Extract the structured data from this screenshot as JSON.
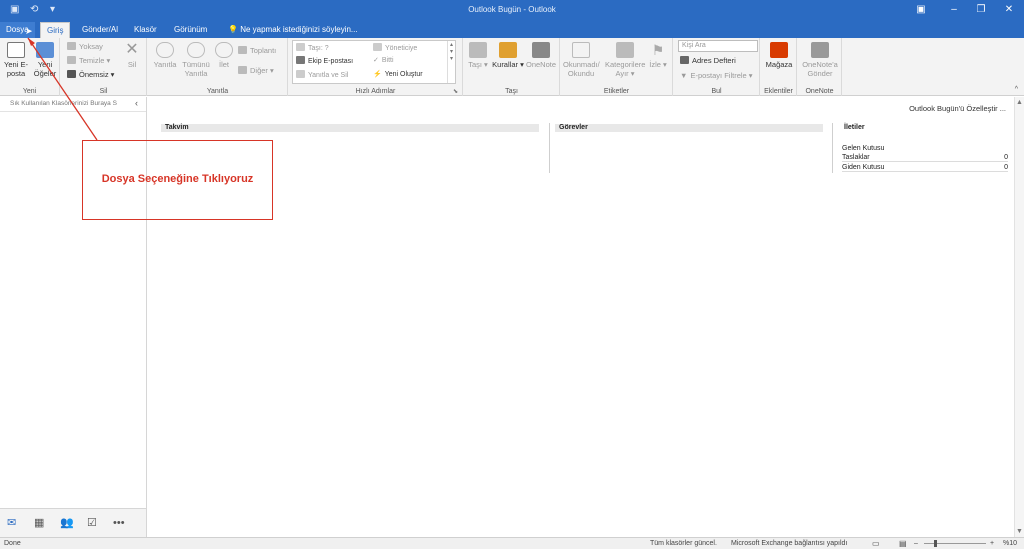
{
  "window": {
    "title": "Outlook Bugün - Outlook"
  },
  "tabs": [
    {
      "label": "Dosya"
    },
    {
      "label": "Giriş"
    },
    {
      "label": "Gönder/Al"
    },
    {
      "label": "Klasör"
    },
    {
      "label": "Görünüm"
    }
  ],
  "tell_me": "Ne yapmak istediğinizi söyleyin...",
  "ribbon": {
    "yeni": {
      "label": "Yeni",
      "new_email": "Yeni E-posta",
      "new_items": "Yeni Öğeler"
    },
    "sil": {
      "label": "Sil",
      "ignore": "Yoksay",
      "clean": "Temizle",
      "junk": "Önemsiz",
      "delete": "Sil"
    },
    "yanitla": {
      "label": "Yanıtla",
      "reply": "Yanıtla",
      "reply_all": "Tümünü Yanıtla",
      "forward": "İlet",
      "meeting": "Toplantı",
      "more": "Diğer"
    },
    "hizli": {
      "label": "Hızlı Adımlar",
      "move_to": "Taşı: ?",
      "team_email": "Ekip E-postası",
      "reply_delete": "Yanıtla ve Sil",
      "manager": "Yöneticiye",
      "done": "Bitti",
      "create_new": "Yeni Oluştur"
    },
    "tasi": {
      "label": "Taşı",
      "move": "Taşı",
      "rules": "Kurallar",
      "onenote": "OneNote"
    },
    "etiketler": {
      "label": "Etiketler",
      "unread_read": "Okunmadı/ Okundu",
      "categorize": "Kategorilere Ayır",
      "follow_up": "İzle"
    },
    "bul": {
      "label": "Bul",
      "search_placeholder": "Kişi Ara",
      "address_book": "Adres Defteri",
      "filter_email": "E-postayı Filtrele"
    },
    "eklentiler": {
      "label": "Eklentiler",
      "store": "Mağaza"
    },
    "onenote": {
      "label": "OneNote",
      "send": "OneNote'a Gönder"
    }
  },
  "nav": {
    "favorites_hint": "Sık Kullanılan Klasörlerinizi Buraya S"
  },
  "main": {
    "customize": "Outlook Bugün'ü Özelleştir ...",
    "calendar": "Takvim",
    "tasks": "Görevler",
    "messages": {
      "title": "İletiler",
      "rows": [
        {
          "name": "Gelen Kutusu",
          "count": ""
        },
        {
          "name": "Taslaklar",
          "count": "0"
        },
        {
          "name": "Giden Kutusu",
          "count": "0"
        }
      ]
    }
  },
  "annotation": {
    "text": "Dosya Seçeneğine Tıklıyoruz",
    "color": "#d73527"
  },
  "status": {
    "left": "Done",
    "folders": "Tüm klasörler güncel.",
    "connection": "Microsoft Exchange bağlantısı yapıldı",
    "zoom": "%10"
  },
  "colors": {
    "accent": "#2b6bc2"
  }
}
